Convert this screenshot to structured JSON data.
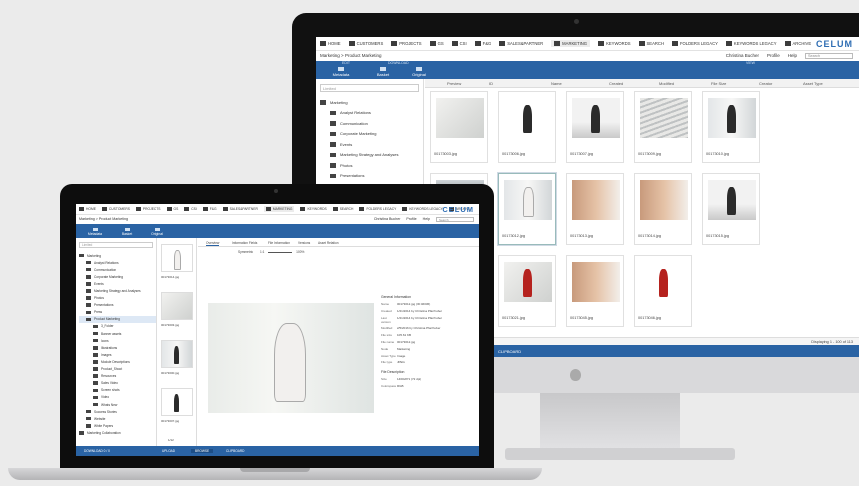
{
  "brand": "CELUM",
  "nav": {
    "items": [
      "HOME",
      "CUSTOMERS",
      "PROJECTS",
      "GS",
      "CSI",
      "F&G",
      "SALES&PARTNER",
      "MARKETING",
      "KEYWORDS",
      "SEARCH",
      "FOLDERS LEGACY",
      "KEYWORDS LEGACY",
      "ARCHIVE"
    ],
    "active": "MARKETING"
  },
  "breadcrumb": {
    "root": "Marketing",
    "sep": ">",
    "current": "Product Marketing"
  },
  "header_right": {
    "user": "Christina Bucher",
    "profile": "Profile",
    "help": "Help",
    "search_placeholder": "Search"
  },
  "toolbar": {
    "group_edit": "EDIT",
    "group_download": "DOWNLOAD",
    "group_view": "VIEW",
    "metadata": "Metadata",
    "basket": "Basket",
    "original": "Original"
  },
  "filter_placeholder": "Limited",
  "monitor": {
    "tree": [
      {
        "label": "Marketing",
        "level": 0,
        "open": true
      },
      {
        "label": "Analyst Relations",
        "level": 1
      },
      {
        "label": "Communication",
        "level": 1
      },
      {
        "label": "Corporate Marketing",
        "level": 1
      },
      {
        "label": "Events",
        "level": 1
      },
      {
        "label": "Marketing Strategy and Analyses",
        "level": 1
      },
      {
        "label": "Photos",
        "level": 1
      },
      {
        "label": "Presentations",
        "level": 1
      },
      {
        "label": "Press",
        "level": 1
      },
      {
        "label": "Product Marketing",
        "level": 1,
        "selected": true
      }
    ],
    "columns": [
      "Preview",
      "ID",
      "Name",
      "Created",
      "Modified",
      "File Size",
      "Creator",
      "Asset Type"
    ],
    "cards": [
      "00173003.jpg",
      "00173006.jpg",
      "00173007.jpg",
      "00173009.jpg",
      "00173010.jpg",
      "00173011.jpg",
      "00173012.jpg",
      "00173013.jpg",
      "00173014.jpg",
      "00173015.jpg",
      "00173018.jpg",
      "00173021.jpg",
      "00173045.jpg",
      "00173046.jpg"
    ],
    "status": {
      "per_page": "100",
      "displaying": "Displaying 1 - 100 of 113"
    },
    "bottom": "CLIPBOARD"
  },
  "laptop": {
    "tree": [
      {
        "label": "Marketing",
        "level": 0
      },
      {
        "label": "Analyst Relations",
        "level": 1
      },
      {
        "label": "Communication",
        "level": 1
      },
      {
        "label": "Corporate Marketing",
        "level": 1
      },
      {
        "label": "Events",
        "level": 1
      },
      {
        "label": "Marketing Strategy and Analyses",
        "level": 1
      },
      {
        "label": "Photos",
        "level": 1
      },
      {
        "label": "Presentations",
        "level": 1
      },
      {
        "label": "Press",
        "level": 1
      },
      {
        "label": "Product Marketing",
        "level": 1,
        "selected": true
      },
      {
        "label": "3_Folder",
        "level": 2
      },
      {
        "label": "Banner assets",
        "level": 2
      },
      {
        "label": "Icons",
        "level": 2
      },
      {
        "label": "Illustrations",
        "level": 2
      },
      {
        "label": "Images",
        "level": 2
      },
      {
        "label": "Module Descriptions",
        "level": 2
      },
      {
        "label": "Product_Shoot",
        "level": 2
      },
      {
        "label": "Resources",
        "level": 2
      },
      {
        "label": "Sales Video",
        "level": 2
      },
      {
        "label": "Screen shots",
        "level": 2
      },
      {
        "label": "Video",
        "level": 2
      },
      {
        "label": "Whats New",
        "level": 2
      },
      {
        "label": "Success Stories",
        "level": 1
      },
      {
        "label": "Website",
        "level": 1
      },
      {
        "label": "White Papers",
        "level": 1
      },
      {
        "label": "Marketing Collaboration",
        "level": 0
      }
    ],
    "thumbs": [
      "00173014.jpg",
      "00173003.jpg",
      "00173000.jpg",
      "00173007.jpg"
    ],
    "pager": "1/12",
    "tabs": [
      "Overview",
      "Information Fields",
      "File Information",
      "Versions",
      "Asset Relation"
    ],
    "active_tab": "Overview",
    "zoom": {
      "mode": "Symmetric",
      "ratio": "1:1",
      "percent": "100%"
    },
    "general_info_title": "General Information",
    "general_info": [
      {
        "k": "Name",
        "v": "00173012.jpg (ID:46036)"
      },
      {
        "k": "Created",
        "v": "1/21/2014 by Christina Pfarrhuber"
      },
      {
        "k": "Last version",
        "v": "1/21/2014 by Christina Pfarrhuber"
      },
      {
        "k": "Modified",
        "v": "2/5/2016 by Christina Pfarrhuber"
      },
      {
        "k": "File size",
        "v": "105.61 KB"
      },
      {
        "k": "File name",
        "v": "00173012.jpg"
      },
      {
        "k": "Node",
        "v": "Marketing"
      },
      {
        "k": "Asset Type",
        "v": "Image"
      },
      {
        "k": "File type",
        "v": "JPEG"
      }
    ],
    "file_desc_title": "File Description",
    "file_desc": [
      {
        "k": "Size",
        "v": "1460x871 (72 dpi)"
      },
      {
        "k": "Colorspace",
        "v": "RGB"
      }
    ],
    "bottom": {
      "download": "DOWNLOAD 0 / 0",
      "upload": "UPLOAD",
      "browse": "BROWSE",
      "clipboard": "CLIPBOARD"
    }
  }
}
